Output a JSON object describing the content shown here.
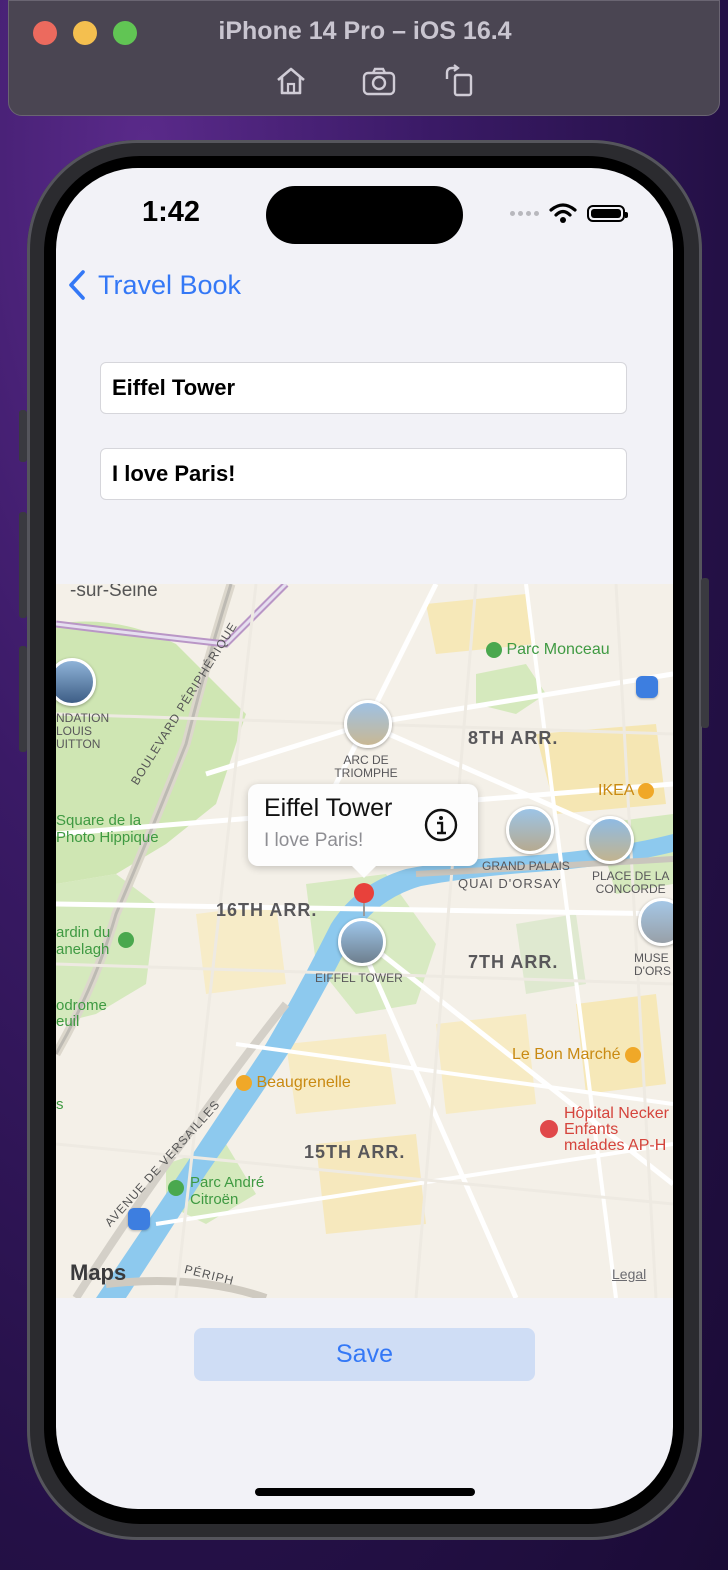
{
  "simulator": {
    "title": "iPhone 14 Pro – iOS 16.4",
    "toolbar": [
      "home-icon",
      "screenshot-icon",
      "rotate-icon"
    ]
  },
  "status_bar": {
    "time": "1:42"
  },
  "nav": {
    "back_label": "Travel Book"
  },
  "form": {
    "name_value": "Eiffel Tower",
    "comment_value": "I love Paris!"
  },
  "map": {
    "labels": {
      "sur_seine": "-sur-Seine",
      "parc_monceau": "Parc Monceau",
      "fondation_1": "NDATION",
      "fondation_2": "LOUIS",
      "fondation_3": "UITTON",
      "arr8": "8TH ARR.",
      "arc_1": "ARC DE",
      "arc_2": "TRIOMPHE",
      "ikea": "IKEA",
      "boulevard_peripherique": "BOULEVARD PÉRIPHÉRIQUE",
      "square_1": "Square de la",
      "square_2": "Photo Hippique",
      "grand_palais": "GRAND PALAIS",
      "quai": "QUAI D'ORSAY",
      "concorde_1": "PLACE DE LA",
      "concorde_2": "CONCORDE",
      "arr16": "16TH ARR.",
      "jardin_1": "ardin du",
      "jardin_2": "anelagh",
      "eiffel_label": "EIFFEL TOWER",
      "arr7": "7TH ARR.",
      "musee_1": "MUSE",
      "musee_2": "D'ORS",
      "hippodrome_1": "odrome",
      "hippodrome_2": "euil",
      "bon_marche": "Le Bon Marché",
      "beaugrenelle": "Beaugrenelle",
      "s": "s",
      "hopital_1": "Hôpital Necker",
      "hopital_2": "Enfants",
      "hopital_3": "malades AP-H",
      "avenue_versailles": "AVENUE DE VERSAILLES",
      "arr15": "15TH ARR.",
      "parc_andre_1": "Parc André",
      "parc_andre_2": "Citroën",
      "periph_bottom": "PÉRIPH",
      "maps": "Maps",
      "legal": "Legal"
    },
    "callout": {
      "title": "Eiffel Tower",
      "subtitle": "I love Paris!"
    }
  },
  "save_button": {
    "label": "Save"
  }
}
